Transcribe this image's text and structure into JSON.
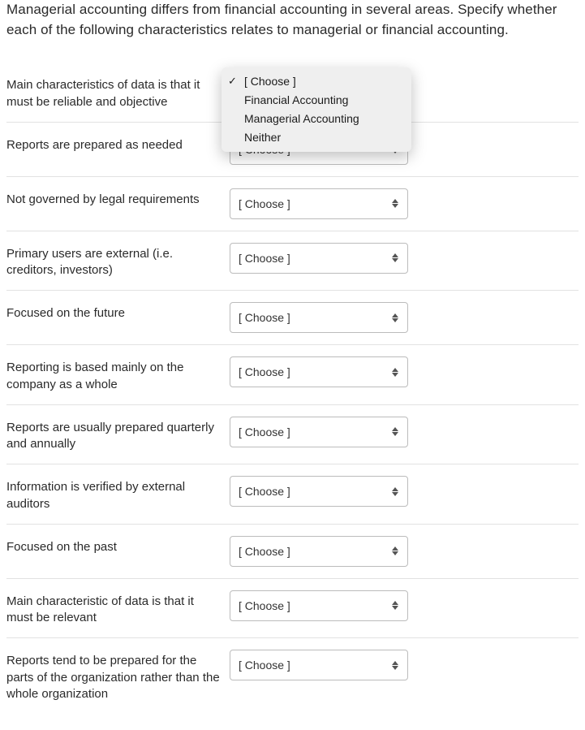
{
  "intro": "Managerial accounting differs from financial accounting in several areas.  Specify whether each of the following characteristics relates to managerial or financial accounting.",
  "choose_placeholder": "[ Choose ]",
  "dropdown_options": [
    "[ Choose ]",
    "Financial Accounting",
    "Managerial Accounting",
    "Neither"
  ],
  "rows": [
    {
      "label": "Main characteristics of data is that it must be reliable and objective"
    },
    {
      "label": "Reports are prepared as needed"
    },
    {
      "label": "Not governed by legal requirements"
    },
    {
      "label": "Primary users are external (i.e. creditors, investors)"
    },
    {
      "label": "Focused on the future"
    },
    {
      "label": "Reporting is based mainly on the company as a whole"
    },
    {
      "label": "Reports are usually prepared quarterly and annually"
    },
    {
      "label": "Information is verified by external auditors"
    },
    {
      "label": "Focused on the past"
    },
    {
      "label": "Main characteristic of data is that it must be relevant"
    },
    {
      "label": "Reports tend to be prepared for the parts of the organization rather than the whole organization"
    }
  ]
}
